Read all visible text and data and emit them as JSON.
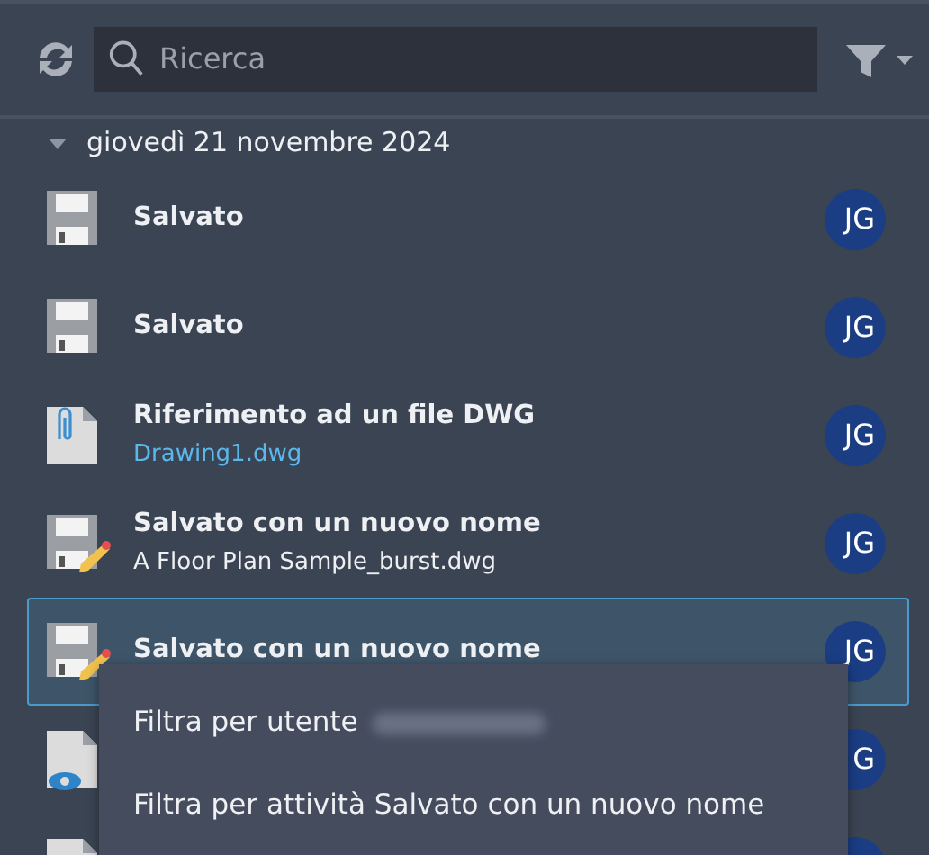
{
  "toolbar": {
    "search": {
      "placeholder": "Ricerca"
    }
  },
  "group": {
    "date": "giovedì 21 novembre 2024",
    "expanded": true
  },
  "rows": [
    {
      "kind": "saved",
      "title": "Salvato",
      "avatar": "JG",
      "selected": false
    },
    {
      "kind": "saved",
      "title": "Salvato",
      "avatar": "JG",
      "selected": false
    },
    {
      "kind": "reference",
      "title": "Riferimento ad un file DWG",
      "link": "Drawing1.dwg",
      "avatar": "JG",
      "selected": false
    },
    {
      "kind": "saved-as",
      "title": "Salvato con un nuovo nome",
      "subtitle": "A Floor Plan Sample_burst.dwg",
      "avatar": "JG",
      "selected": false
    },
    {
      "kind": "saved-as",
      "title": "Salvato con un nuovo nome",
      "avatar": "JG",
      "selected": true
    },
    {
      "kind": "viewed",
      "avatar": "G",
      "selected": false
    },
    {
      "kind": "file",
      "selected": false
    }
  ],
  "context_menu": {
    "items": [
      {
        "label": "Filtra per utente",
        "redacted": true
      },
      {
        "label": "Filtra per attività Salvato con un nuovo nome",
        "redacted": false
      }
    ]
  }
}
